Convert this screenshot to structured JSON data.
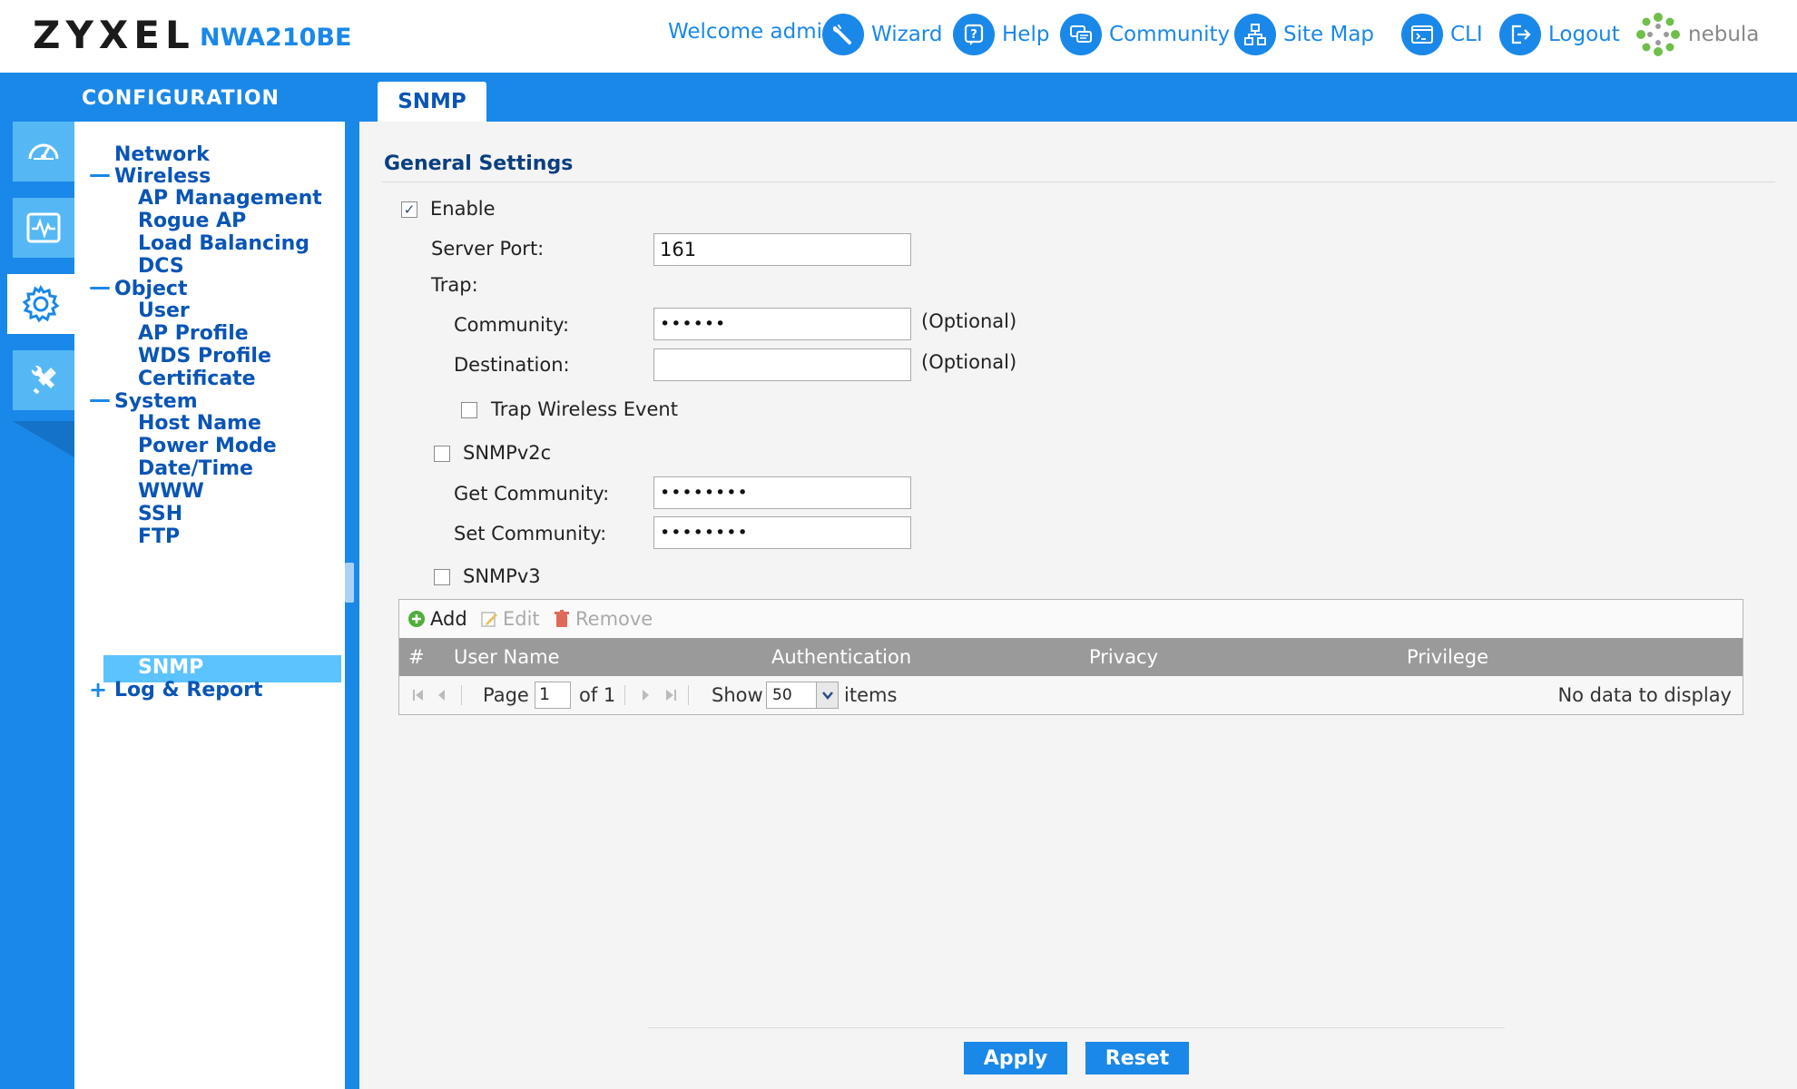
{
  "header": {
    "brand": "ZYXEL",
    "model": "NWA210BE",
    "welcome": "Welcome admin",
    "links": {
      "wizard": "Wizard",
      "help": "Help",
      "community": "Community",
      "site_map": "Site Map",
      "cli": "CLI",
      "logout": "Logout"
    },
    "nebula": "nebula"
  },
  "band": {
    "config_label": "CONFIGURATION",
    "active_tab": "SNMP"
  },
  "rail": {
    "items": [
      "dashboard-icon",
      "monitor-icon",
      "configuration-icon",
      "maintenance-icon"
    ],
    "active": "configuration-icon"
  },
  "tree": {
    "network": "Network",
    "wireless": "Wireless",
    "ap_management": "AP Management",
    "rogue_ap": "Rogue AP",
    "load_balancing": "Load Balancing",
    "dcs": "DCS",
    "object": "Object",
    "user": "User",
    "ap_profile": "AP Profile",
    "wds_profile": "WDS Profile",
    "certificate": "Certificate",
    "system": "System",
    "host_name": "Host Name",
    "power_mode": "Power Mode",
    "date_time": "Date/Time",
    "www": "WWW",
    "ssh": "SSH",
    "ftp": "FTP",
    "snmp": "SNMP",
    "log_report": "Log & Report",
    "expanded_marker": "—",
    "collapsed_marker": "+"
  },
  "general": {
    "title": "General Settings",
    "enable_label": "Enable",
    "enable_checked": true,
    "server_port_label": "Server Port:",
    "server_port_value": "161",
    "trap_label": "Trap:",
    "community_label": "Community:",
    "community_value": "••••••",
    "optional": "(Optional)",
    "destination_label": "Destination:",
    "destination_value": "",
    "trap_wireless_label": "Trap Wireless Event",
    "trap_wireless_checked": false,
    "snmpv2c_label": "SNMPv2c",
    "snmpv2c_checked": false,
    "get_community_label": "Get Community:",
    "get_community_value": "••••••••",
    "set_community_label": "Set Community:",
    "set_community_value": "••••••••",
    "snmpv3_label": "SNMPv3",
    "snmpv3_checked": false
  },
  "table": {
    "toolbar": {
      "add": "Add",
      "edit": "Edit",
      "remove": "Remove"
    },
    "columns": [
      "#",
      "User Name",
      "Authentication",
      "Privacy",
      "Privilege"
    ],
    "footer": {
      "page_label": "Page",
      "page_value": "1",
      "of_label": "of 1",
      "show_label": "Show",
      "show_value": "50",
      "items_label": "items",
      "empty": "No data to display"
    }
  },
  "actions": {
    "apply": "Apply",
    "reset": "Reset"
  },
  "colors": {
    "accent": "#1a88e8",
    "link": "#0a55b5",
    "selected": "#5cc3ff"
  }
}
